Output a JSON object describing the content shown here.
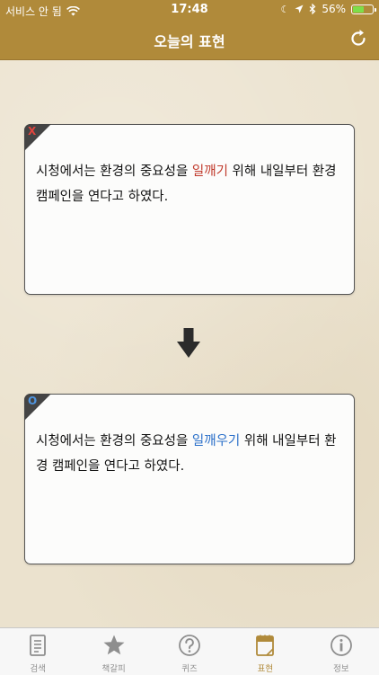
{
  "status": {
    "carrier": "서비스 안 됨",
    "time": "17:48",
    "battery_text": "56%",
    "battery_level": 0.56
  },
  "nav": {
    "title": "오늘의 표현"
  },
  "cards": {
    "wrong": {
      "mark": "X",
      "before": "시청에서는 환경의 중요성을 ",
      "highlight": "일깨기",
      "after": " 위해 내일부터 환경 캠페인을 연다고 하였다."
    },
    "right": {
      "mark": "O",
      "before": "시청에서는 환경의 중요성을 ",
      "highlight": "일깨우기",
      "after": " 위해 내일부터 환경 캠페인을 연다고 하였다."
    }
  },
  "tabs": [
    {
      "label": "검색"
    },
    {
      "label": "책갈피"
    },
    {
      "label": "퀴즈"
    },
    {
      "label": "표현"
    },
    {
      "label": "정보"
    }
  ],
  "colors": {
    "header": "#b08a3a",
    "accent": "#b08a3a",
    "wrong_highlight": "#c0392b",
    "right_highlight": "#2a6fc9",
    "inactive_tab": "#8e8e8e"
  }
}
